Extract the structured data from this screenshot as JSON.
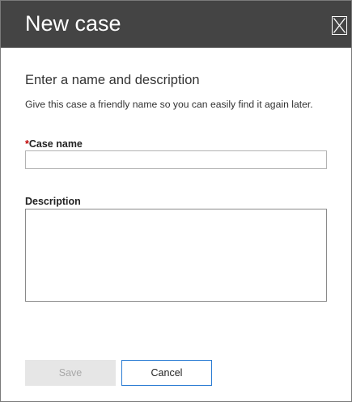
{
  "dialog": {
    "title": "New case",
    "close_icon": "close-x-icon",
    "section_title": "Enter a name and description",
    "section_description": "Give this case a friendly name so you can easily find it again later."
  },
  "form": {
    "case_name": {
      "required_marker": "*",
      "label": "Case name",
      "value": ""
    },
    "description": {
      "label": "Description",
      "value": ""
    }
  },
  "buttons": {
    "save_label": "Save",
    "save_enabled": false,
    "cancel_label": "Cancel"
  },
  "colors": {
    "header_bg": "#444444",
    "required": "#c00000",
    "focus_border": "#2b7cd3"
  }
}
